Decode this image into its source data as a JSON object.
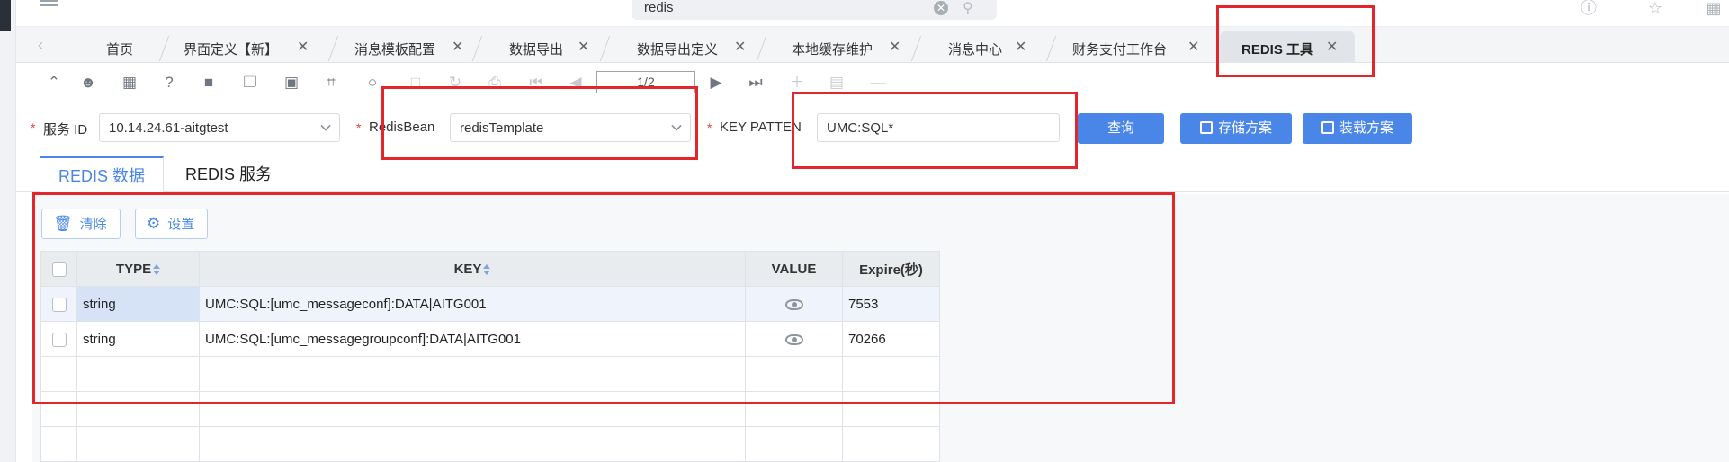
{
  "search": {
    "value": "redis"
  },
  "tabs": [
    {
      "label": "首页",
      "closable": false
    },
    {
      "label": "界面定义【新】",
      "closable": true
    },
    {
      "label": "消息模板配置",
      "closable": true
    },
    {
      "label": "数据导出",
      "closable": true
    },
    {
      "label": "数据导出定义",
      "closable": true
    },
    {
      "label": "本地缓存维护",
      "closable": true
    },
    {
      "label": "消息中心",
      "closable": true
    },
    {
      "label": "财务支付工作台",
      "closable": true
    },
    {
      "label": "REDIS 工具",
      "closable": true,
      "active": true
    }
  ],
  "tab_close_glyph": "✕",
  "pager": {
    "text": "1/2"
  },
  "form": {
    "service_id_label": "服务 ID",
    "service_id_value": "10.14.24.61-aitgtest",
    "redisbean_label": "RedisBean",
    "redisbean_value": "redisTemplate",
    "key_pattern_label": "KEY PATTEN",
    "key_pattern_value": "UMC:SQL*",
    "required_mark": "*",
    "query_button": "查询",
    "save_scheme_button": "存储方案",
    "load_scheme_button": "装载方案"
  },
  "subtabs": {
    "data": "REDIS 数据",
    "service": "REDIS 服务"
  },
  "actions": {
    "clear": "清除",
    "settings": "设置"
  },
  "table": {
    "headers": {
      "type": "TYPE",
      "key": "KEY",
      "value": "VALUE",
      "expire": "Expire(秒)"
    },
    "rows": [
      {
        "type": "string",
        "key": "UMC:SQL:[umc_messageconf]:DATA|AITG001",
        "expire": "7553"
      },
      {
        "type": "string",
        "key": "UMC:SQL:[umc_messagegroupconf]:DATA|AITG001",
        "expire": "70266"
      }
    ]
  },
  "colors": {
    "accent": "#4a86e8",
    "annotation": "#e3262b"
  }
}
